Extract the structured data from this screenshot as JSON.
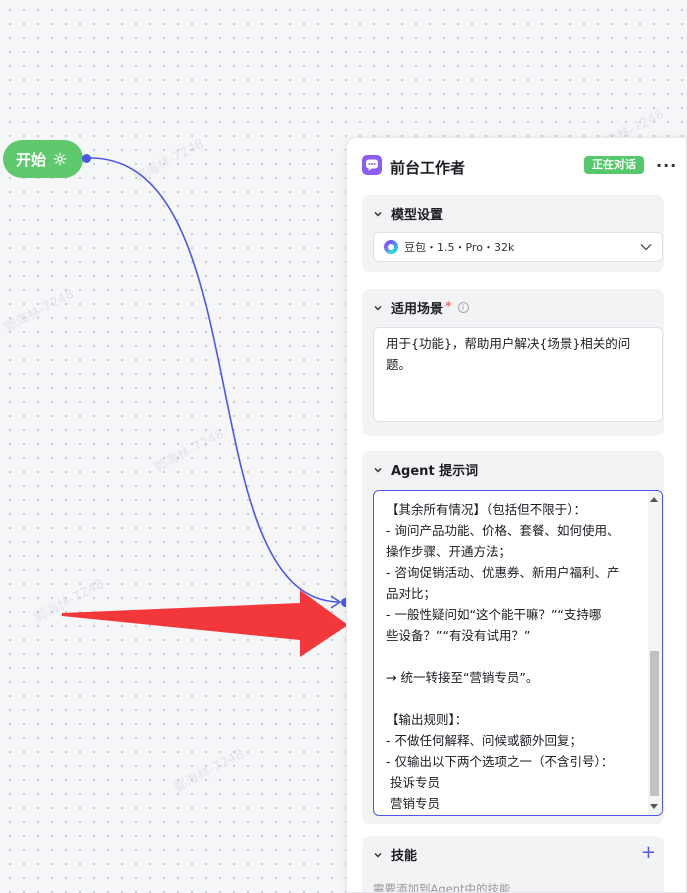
{
  "canvas": {
    "start_node": {
      "label": "开始",
      "color": "#5ec86d"
    },
    "edge_color": "#4c58e8",
    "arrow_color": "#f2383a",
    "watermark_text": "郭海林-7248"
  },
  "panel": {
    "title": "前台工作者",
    "status": "正在对话",
    "status_color": "#54c86b",
    "sections": {
      "model": {
        "title": "模型设置",
        "selected_model": "豆包・1.5・Pro・32k"
      },
      "scenario": {
        "title": "适用场景",
        "required_mark": "*",
        "text": "用于{功能}，帮助用户解决{场景}相关的问题。"
      },
      "prompt": {
        "title": "Agent 提示词",
        "lines": [
          "【其余所有情况】（包括但不限于）：",
          "- 询问产品功能、价格、套餐、如何使用、",
          "操作步骤、开通方法；",
          "- 咨询促销活动、优惠券、新用户福利、产",
          "品对比；",
          "- 一般性疑问如“这个能干嘛？”“支持哪",
          "些设备？”“有没有试用？”",
          "",
          "→ 统一转接至“营销专员”。",
          "",
          "【输出规则】：",
          "- 不做任何解释、问候或额外回复；",
          "- 仅输出以下两个选项之一（不含引号）：",
          " 投诉专员",
          " 营销专员"
        ]
      },
      "skills": {
        "title": "技能",
        "hint": "需要添加到Agent中的技能"
      }
    }
  }
}
